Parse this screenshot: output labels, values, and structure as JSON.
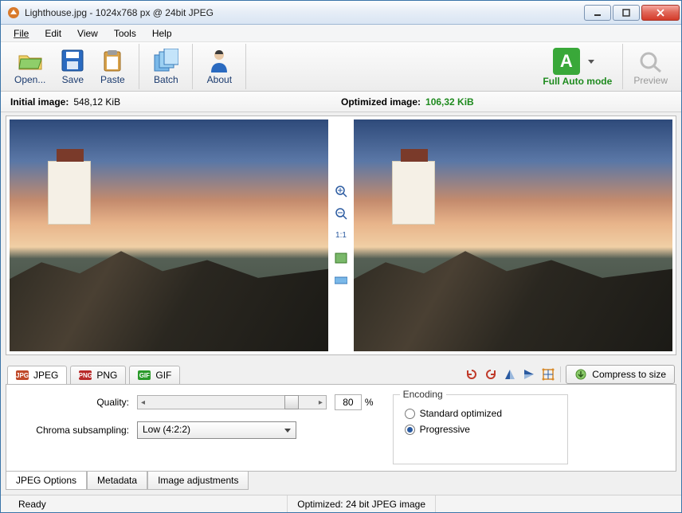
{
  "window": {
    "title": "Lighthouse.jpg - 1024x768 px @ 24bit JPEG"
  },
  "menu": {
    "file": "File",
    "edit": "Edit",
    "view": "View",
    "tools": "Tools",
    "help": "Help"
  },
  "toolbar": {
    "open": "Open...",
    "save": "Save",
    "paste": "Paste",
    "batch": "Batch",
    "about": "About",
    "auto_mode": "Full Auto mode",
    "preview": "Preview"
  },
  "sizes": {
    "initial_label": "Initial image:",
    "initial_value": "548,12 KiB",
    "optimized_label": "Optimized image:",
    "optimized_value": "106,32 KiB"
  },
  "midtools": {
    "ratio": "1:1"
  },
  "format_tabs": {
    "jpeg": "JPEG",
    "png": "PNG",
    "gif": "GIF"
  },
  "actions": {
    "compress": "Compress to size"
  },
  "options": {
    "quality_label": "Quality:",
    "quality_value": "80",
    "quality_pct": "%",
    "chroma_label": "Chroma subsampling:",
    "chroma_value": "Low (4:2:2)",
    "encoding_legend": "Encoding",
    "encoding_standard": "Standard optimized",
    "encoding_progressive": "Progressive"
  },
  "bottom_tabs": {
    "jpeg_options": "JPEG Options",
    "metadata": "Metadata",
    "image_adjustments": "Image adjustments"
  },
  "status": {
    "ready": "Ready",
    "optimized": "Optimized: 24 bit JPEG image"
  },
  "colors": {
    "accent_green": "#1e8a1e"
  }
}
